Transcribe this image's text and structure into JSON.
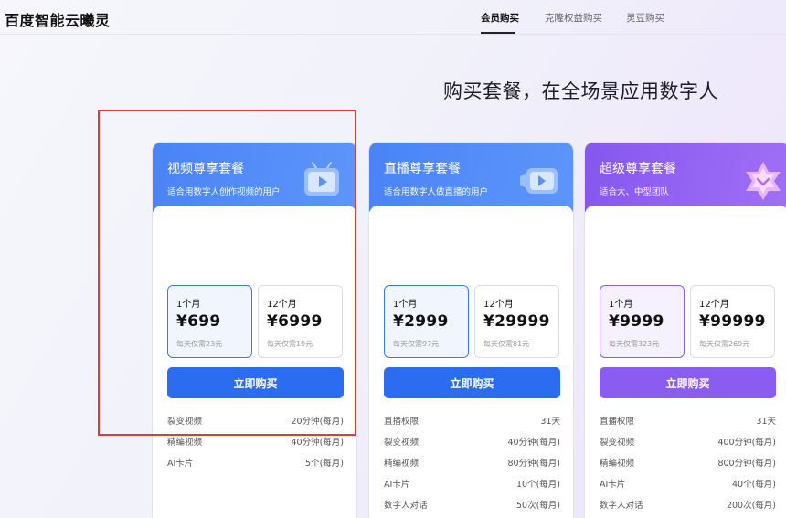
{
  "header": {
    "logo": "百度智能云曦灵",
    "nav": [
      {
        "label": "会员购买",
        "active": true
      },
      {
        "label": "克隆权益购买",
        "active": false
      },
      {
        "label": "灵豆购买",
        "active": false
      }
    ]
  },
  "headline": "购买套餐，在全场景应用数字人",
  "cards": [
    {
      "title": "视频尊享套餐",
      "subtitle": "适合用数字人创作视频的用户",
      "icon": "tv-play-icon",
      "accent": "#2c6cf0",
      "options": [
        {
          "period": "1个月",
          "price": "¥699",
          "daily": "每天仅需23元",
          "selected": true
        },
        {
          "period": "12个月",
          "price": "¥6999",
          "daily": "每天仅需19元",
          "selected": false
        }
      ],
      "button": "立即购买",
      "features": [
        {
          "name": "裂变视频",
          "value": "20分钟(每月)"
        },
        {
          "name": "精编视频",
          "value": "40分钟(每月)"
        },
        {
          "name": "AI卡片",
          "value": "5个(每月)"
        }
      ]
    },
    {
      "title": "直播尊享套餐",
      "subtitle": "适合用数字人做直播的用户",
      "icon": "video-camera-icon",
      "accent": "#2c6cf0",
      "options": [
        {
          "period": "1个月",
          "price": "¥2999",
          "daily": "每天仅需97元",
          "selected": true
        },
        {
          "period": "12个月",
          "price": "¥29999",
          "daily": "每天仅需81元",
          "selected": false
        }
      ],
      "button": "立即购买",
      "features": [
        {
          "name": "直播权限",
          "value": "31天"
        },
        {
          "name": "裂变视频",
          "value": "40分钟(每月)"
        },
        {
          "name": "精编视频",
          "value": "80分钟(每月)"
        },
        {
          "name": "AI卡片",
          "value": "10个(每月)"
        },
        {
          "name": "数字人对话",
          "value": "50次(每月)"
        }
      ]
    },
    {
      "title": "超级尊享套餐",
      "subtitle": "适合大、中型团队",
      "icon": "star-crown-icon",
      "accent": "#8b5cf0",
      "options": [
        {
          "period": "1个月",
          "price": "¥9999",
          "daily": "每天仅需323元",
          "selected": true
        },
        {
          "period": "12个月",
          "price": "¥99999",
          "daily": "每天仅需269元",
          "selected": false
        }
      ],
      "button": "立即购买",
      "features": [
        {
          "name": "直播权限",
          "value": "31天"
        },
        {
          "name": "裂变视频",
          "value": "400分钟(每月)"
        },
        {
          "name": "精编视频",
          "value": "800分钟(每月)"
        },
        {
          "name": "AI卡片",
          "value": "40个(每月)"
        },
        {
          "name": "数字人对话",
          "value": "200次(每月)"
        }
      ]
    }
  ]
}
